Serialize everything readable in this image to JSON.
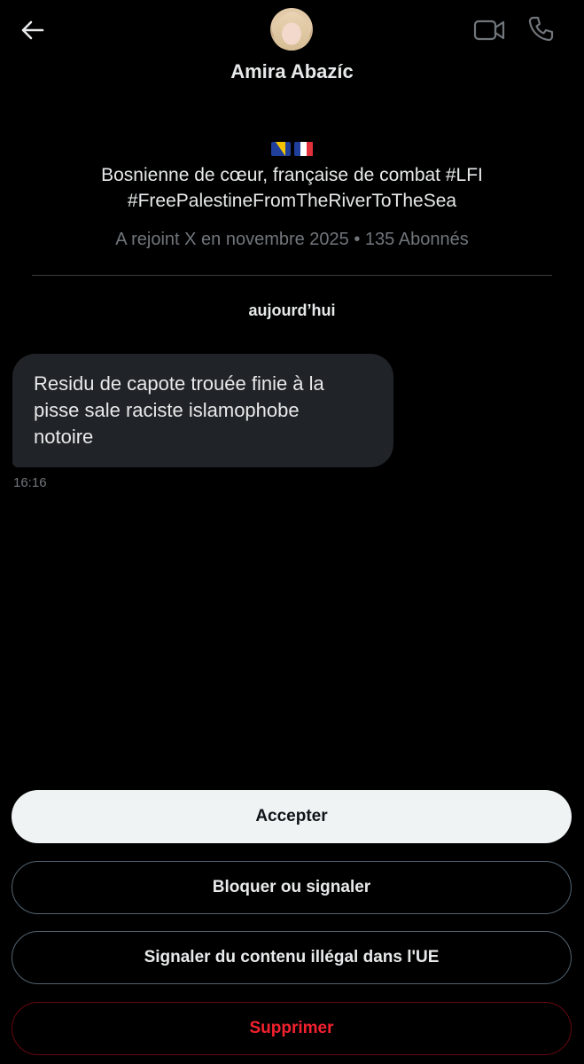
{
  "header": {
    "back_icon": "arrow-left-icon",
    "contact_name": "Amira Abazíc",
    "video_icon": "video-camera-icon",
    "call_icon": "phone-icon"
  },
  "profile": {
    "flags": [
      "bosnia-flag-icon",
      "france-flag-icon"
    ],
    "bio_line_1": "Bosnienne de cœur, française de combat #LFI",
    "bio_line_2": "#FreePalestineFromTheRiverToTheSea",
    "meta": "A rejoint X en novembre 2025 • 135 Abonnés"
  },
  "conversation": {
    "day_label": "aujourd’hui",
    "messages": [
      {
        "lines": [
          "Residu de capote trouée finie à la",
          "pisse sale raciste islamophobe",
          "notoire"
        ],
        "time": "16:16"
      }
    ]
  },
  "actions": {
    "accept": "Accepter",
    "block_report": "Bloquer ou signaler",
    "report_illegal": "Signaler du contenu illégal dans l'UE",
    "delete": "Supprimer"
  },
  "colors": {
    "background": "#000000",
    "text_primary": "#e7e9ea",
    "text_secondary": "#71767b",
    "bubble": "#202327",
    "danger": "#f4212e",
    "button_light": "#eff3f4"
  }
}
